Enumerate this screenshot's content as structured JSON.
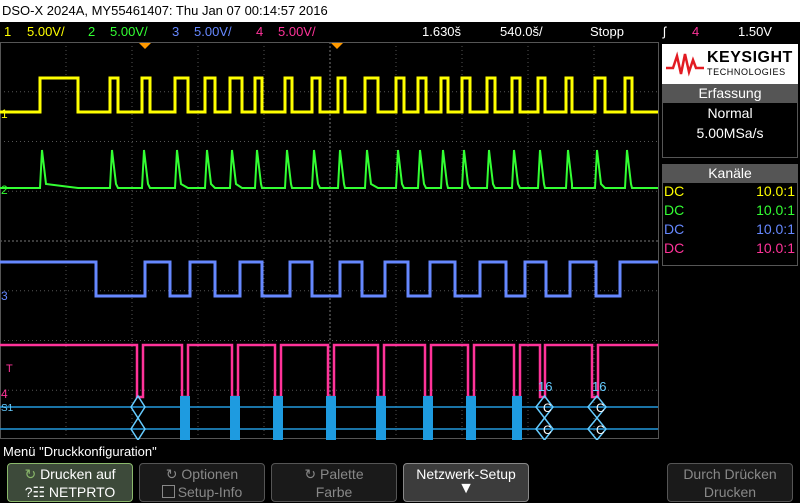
{
  "title": "DSO-X 2024A, MY55461407: Thu Jan 07 00:14:57 2016",
  "channels": [
    {
      "num": "1",
      "scale": "5.00V/",
      "color": "#ffff00"
    },
    {
      "num": "2",
      "scale": "5.00V/",
      "color": "#33ff33"
    },
    {
      "num": "3",
      "scale": "5.00V/",
      "color": "#6688ff"
    },
    {
      "num": "4",
      "scale": "5.00V/",
      "color": "#ff3399"
    }
  ],
  "timebase": {
    "delay": "1.630š",
    "scale": "540.0š/",
    "run_state": "Stopp"
  },
  "trigger": {
    "icon": "trigger-edge-icon",
    "channel": "4",
    "level": "1.50V"
  },
  "logo": {
    "line1": "KEYSIGHT",
    "line2": "TECHNOLOGIES"
  },
  "acquisition": {
    "header": "Erfassung",
    "mode": "Normal",
    "rate": "5.00MSa/s"
  },
  "channel_panel": {
    "header": "Kanäle",
    "rows": [
      {
        "coupling": "DC",
        "ratio": "10.0:1",
        "color": "#ffff00"
      },
      {
        "coupling": "DC",
        "ratio": "10.0:1",
        "color": "#33ff33"
      },
      {
        "coupling": "DC",
        "ratio": "10.0:1",
        "color": "#6688ff"
      },
      {
        "coupling": "DC",
        "ratio": "10.0:1",
        "color": "#ff3399"
      }
    ]
  },
  "markers": {
    "ch1": "1",
    "ch2": "2",
    "ch3": "3",
    "ch4": "4",
    "trig": "T",
    "serial": "S1",
    "bus_values": [
      "16",
      "16"
    ],
    "bus_symbols": [
      "C",
      "C"
    ]
  },
  "menu_title": "Menü \"Druckkonfiguration\"",
  "softkeys": {
    "print": {
      "line1": "Drucken auf",
      "line2": "NETPRTO"
    },
    "options": {
      "line1": "Optionen",
      "line2": "Setup-Info"
    },
    "palette": {
      "line1": "Palette",
      "line2": "Farbe"
    },
    "network": {
      "line1": "Netzwerk-Setup"
    },
    "grid": {
      "line1": "Durch Drücken",
      "line2": "Drucken"
    }
  }
}
